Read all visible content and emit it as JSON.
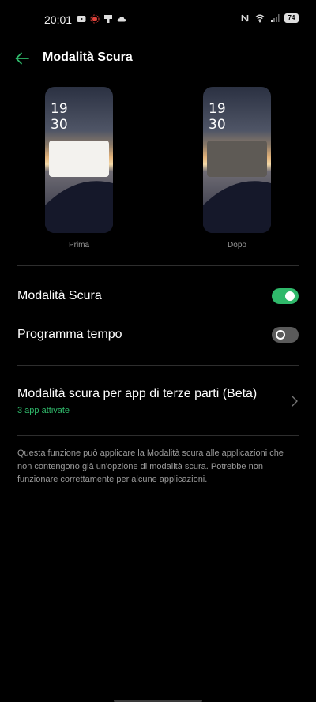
{
  "status_bar": {
    "time": "20:01",
    "battery": "74"
  },
  "app_bar": {
    "title": "Modalità Scura"
  },
  "preview": {
    "before": {
      "clock_hour": "19",
      "clock_minute": "30",
      "label": "Prima"
    },
    "after": {
      "clock_hour": "19",
      "clock_minute": "30",
      "label": "Dopo"
    }
  },
  "settings": {
    "dark_mode": {
      "label": "Modalità Scura",
      "enabled": true
    },
    "schedule": {
      "label": "Programma tempo",
      "enabled": false
    },
    "third_party": {
      "label": "Modalità scura per app di terze parti (Beta)",
      "subtitle": "3 app attivate"
    }
  },
  "description": "Questa funzione può applicare la Modalità scura alle applicazioni che non contengono già un'opzione di modalità scura. Potrebbe non funzionare correttamente per alcune applicazioni.",
  "colors": {
    "accent": "#2fb86a",
    "background": "#000000",
    "secondary_text": "#9a9a9a"
  }
}
